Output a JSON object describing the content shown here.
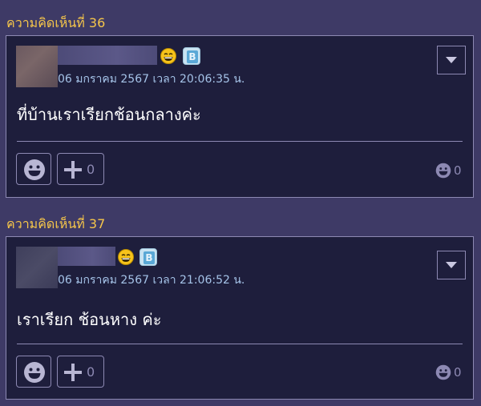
{
  "comments": [
    {
      "label": "ความคิดเห็นที่ 36",
      "timestamp": "06 มกราคม 2567 เวลา 20:06:35 น.",
      "text": "ที่บ้านเราเรียกช้อนกลางค่ะ",
      "plus_count": "0",
      "emotion_count": "0",
      "badge": "B"
    },
    {
      "label": "ความคิดเห็นที่ 37",
      "timestamp": "06 มกราคม 2567 เวลา 21:06:52 น.",
      "text": "เราเรียก ช้อนหาง ค่ะ",
      "plus_count": "0",
      "emotion_count": "0",
      "badge": "B"
    }
  ],
  "colors": {
    "background": "#3e3a66",
    "card": "#1e1e3c",
    "label": "#f6c64a",
    "timestamp": "#a5c3e8",
    "border": "#8d89b3"
  },
  "icons": [
    "laughing-emoji-icon",
    "blog-b-badge-icon",
    "caret-down-icon",
    "smiley-face-icon",
    "plus-icon"
  ]
}
